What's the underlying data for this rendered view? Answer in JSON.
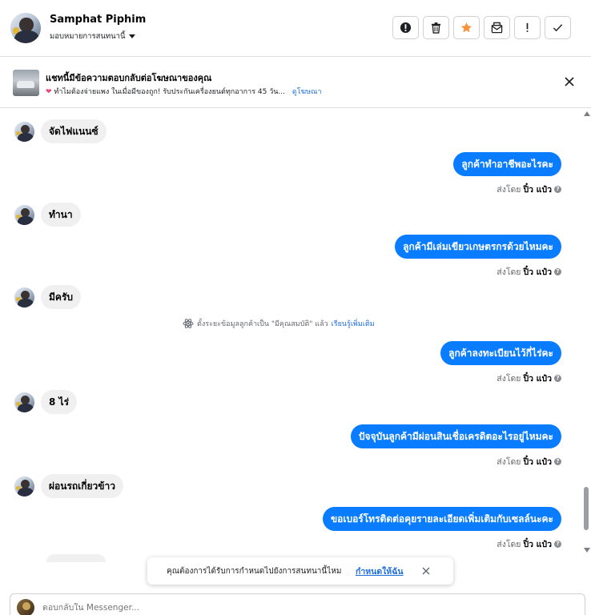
{
  "header": {
    "name": "Samphat Piphim",
    "assign_label": "มอบหมายการสนทนานี้",
    "tools": [
      {
        "name": "spam-icon"
      },
      {
        "name": "trash-icon"
      },
      {
        "name": "star-icon"
      },
      {
        "name": "mark-unread-icon"
      },
      {
        "name": "follow-up-icon"
      },
      {
        "name": "done-icon"
      }
    ]
  },
  "ad": {
    "title": "แชทนี้มีข้อความตอบกลับต่อโฆษณาของคุณ",
    "subtitle": "ทำไมต้องจ่ายแพง ในเมื่อมีของถูก! รับประกันเครื่องยนต์ทุกอาการ 45 วัน...",
    "link": "ดูโฆษณา"
  },
  "messages": {
    "sent_prefix": "ส่งโดย",
    "sender": "ปิ๋ว แป๋ว",
    "info_mark": "?",
    "in": [
      "จัดไฟแนนซ์",
      "ทำนา",
      "มีครับ",
      "8 ไร่",
      "ผ่อนรถเกี่ยวข้าว"
    ],
    "out": [
      "ลูกค้าทำอาชีพอะไรคะ",
      "ลูกค้ามีเล่มเขียวเกษตรกรด้วยไหมคะ",
      "ลูกค้าลงทะเบียนไว้กี่ไร่คะ",
      "ปัจจุบันลูกค้ามีผ่อนสินเชื่อเครดิตอะไรอยู่ไหมคะ",
      "ขอเบอร์โทรติดต่อคุยรายละเอียดเพิ่มเติมกับเซลล์นะคะ"
    ],
    "system_note": "ตั้งระยะข้อมูลลูกค้าเป็น \"มีคุณสมบัติ\" แล้ว",
    "system_link": "เรียนรู้เพิ่มเติม"
  },
  "toast": {
    "text": "คุณต้องการได้รับการกำหนดไปยังการสนทนานี้ไหม",
    "link": "กำหนดให้ฉัน"
  },
  "reply": {
    "placeholder": "ตอบกลับใน Messenger..."
  },
  "colors": {
    "accent": "#0A7CFF",
    "star": "#F7923A",
    "link": "#216FDB"
  }
}
